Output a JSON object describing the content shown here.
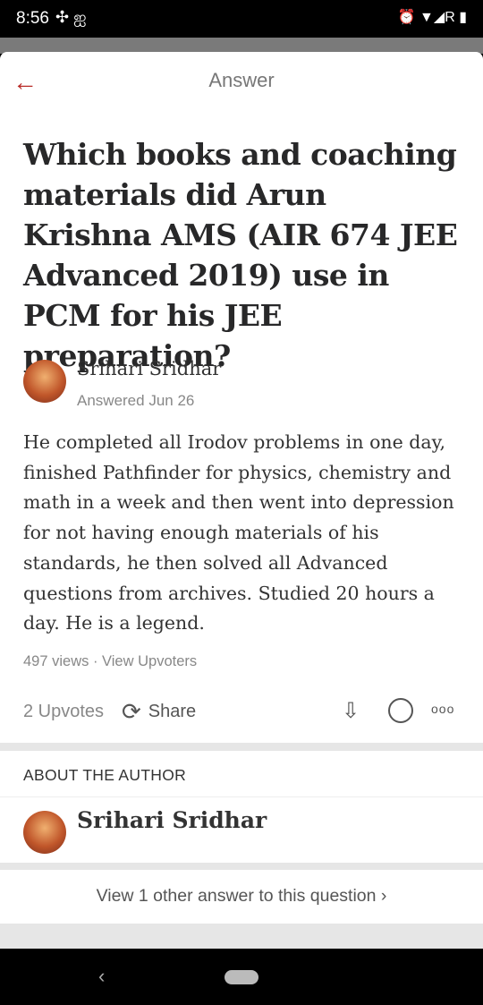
{
  "status_bar": {
    "time": "8:56",
    "left_icons": "✣ ஐ",
    "right_icons": "⏰ ▼◢R ▮"
  },
  "topbar": {
    "title": "Answer",
    "back_icon": "←"
  },
  "question": {
    "text": "Which books and coaching materials did Arun Krishna AMS (AIR 674 JEE Advanced 2019) use in PCM for his JEE preparation?"
  },
  "answer": {
    "author": "Srihari Sridhar",
    "answered": "Answered Jun 26",
    "body": "He completed all Irodov problems in one day, finished Pathfinder for physics, chemistry and math in a week and then went into depression for not having enough materials of his standards, he then solved all Advanced questions from archives. Studied 20 hours a day. He is a legend.",
    "views": "497 views",
    "separator": " · ",
    "view_upvoters": "View Upvoters"
  },
  "actions": {
    "upvotes": "2 Upvotes",
    "share": "Share"
  },
  "about": {
    "header": "ABOUT THE AUTHOR",
    "name": "Srihari Sridhar"
  },
  "other_answers": {
    "text": "View 1 other answer to this question",
    "chevron": "›"
  },
  "nav": {
    "back": "‹"
  },
  "colors": {
    "accent": "#b92b27",
    "text": "#282829",
    "muted": "#888888"
  }
}
